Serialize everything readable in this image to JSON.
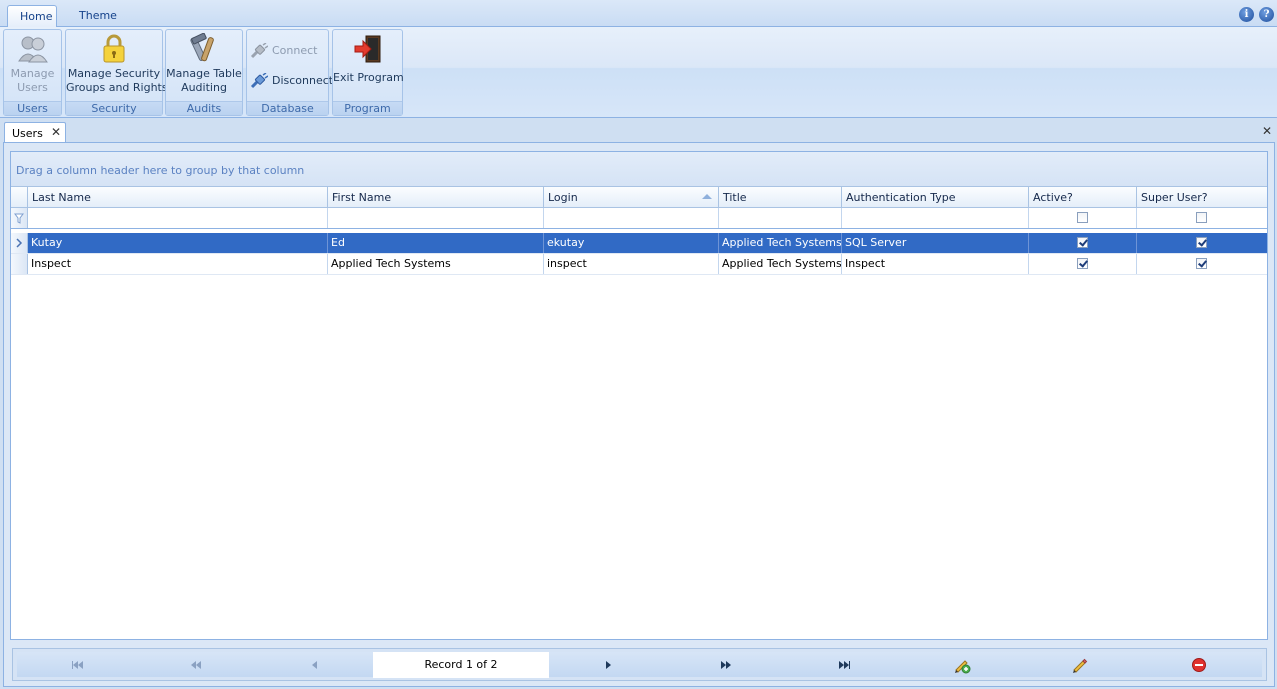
{
  "ribbon": {
    "tabs": [
      {
        "label": "Home",
        "active": true
      },
      {
        "label": "Theme",
        "active": false
      }
    ],
    "help_icons": [
      "info-icon",
      "help-icon"
    ],
    "groups": [
      {
        "label": "Users",
        "buttons": [
          {
            "line1": "Manage",
            "line2": "Users",
            "enabled": false,
            "icon": "users-icon"
          }
        ]
      },
      {
        "label": "Security",
        "buttons": [
          {
            "line1": "Manage Security",
            "line2": "Groups and Rights",
            "enabled": true,
            "icon": "padlock-icon"
          }
        ]
      },
      {
        "label": "Audits",
        "buttons": [
          {
            "line1": "Manage Table",
            "line2": "Auditing",
            "enabled": true,
            "icon": "tools-icon"
          }
        ]
      },
      {
        "label": "Database",
        "buttons": [
          {
            "label": "Connect",
            "enabled": false,
            "icon": "plug-icon"
          },
          {
            "label": "Disconnect",
            "enabled": true,
            "icon": "plug-icon"
          }
        ]
      },
      {
        "label": "Program",
        "buttons": [
          {
            "label": "Exit Program",
            "enabled": true,
            "icon": "exit-door-icon"
          }
        ]
      }
    ]
  },
  "document_tab": {
    "label": "Users",
    "close_glyph": "✕"
  },
  "close_all_glyph": "✕",
  "grid": {
    "group_panel_hint": "Drag a column header here to group by that column",
    "columns": [
      "Last Name",
      "First Name",
      "Login",
      "Title",
      "Authentication Type",
      "Active?",
      "Super User?"
    ],
    "sorted_column": "Login",
    "sort_direction": "ascending",
    "rows": [
      {
        "last_name": "Kutay",
        "first_name": "Ed",
        "login": "ekutay",
        "title": "Applied Tech Systems",
        "auth_type": "SQL Server",
        "active": true,
        "super_user": true,
        "selected": true
      },
      {
        "last_name": "Inspect",
        "first_name": "Applied Tech Systems",
        "login": "inspect",
        "title": "Applied Tech Systems",
        "auth_type": "Inspect",
        "active": true,
        "super_user": true,
        "selected": false
      }
    ]
  },
  "navigator": {
    "record_text": "Record 1 of 2",
    "buttons": [
      "first-record",
      "previous-page",
      "previous-record",
      "next-record",
      "next-page",
      "last-record",
      "append",
      "edit",
      "delete"
    ]
  },
  "colors": {
    "selection": "#316ac5",
    "ribbon_text": "#15428b",
    "delete_red": "#e0312f"
  }
}
